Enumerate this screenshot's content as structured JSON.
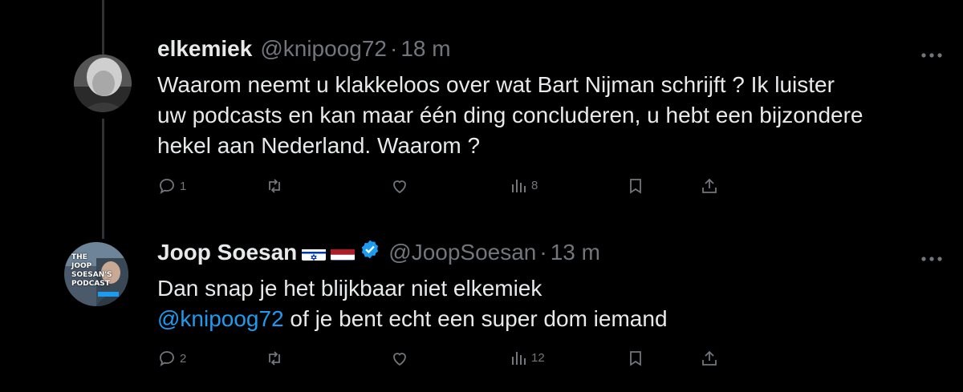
{
  "tweets": [
    {
      "display_name": "elkemiek",
      "handle": "@knipoog72",
      "separator": "·",
      "time": "18 m",
      "text_lines": [
        "Waarom neemt u klakkeloos over wat Bart Nijman schrijft ? Ik luister",
        "uw podcasts en kan maar één ding concluderen, u hebt een bijzondere",
        "hekel aan Nederland. Waarom ?"
      ],
      "replies": "1",
      "reposts": "",
      "likes": "",
      "views": "8"
    },
    {
      "display_name": "Joop Soesan",
      "handle": "@JoopSoesan",
      "separator": "·",
      "time": "13 m",
      "text_line1": "Dan snap je het blijkbaar niet elkemiek",
      "mention": "@knipoog72",
      "text_line2_rest": " of je bent echt een super dom iemand",
      "replies": "2",
      "reposts": "",
      "likes": "",
      "views": "12",
      "avatar_text": [
        "THE",
        "JOOP",
        "SOESAN'S",
        "PODCAST"
      ]
    }
  ],
  "colors": {
    "background": "#000000",
    "text": "#e7e9ea",
    "muted": "#71767b",
    "accent": "#1d9bf0"
  },
  "icons": [
    "more-icon",
    "reply-icon",
    "repost-icon",
    "like-icon",
    "views-icon",
    "bookmark-icon",
    "share-icon",
    "verified-badge-icon",
    "israel-flag-icon",
    "netherlands-flag-icon"
  ]
}
